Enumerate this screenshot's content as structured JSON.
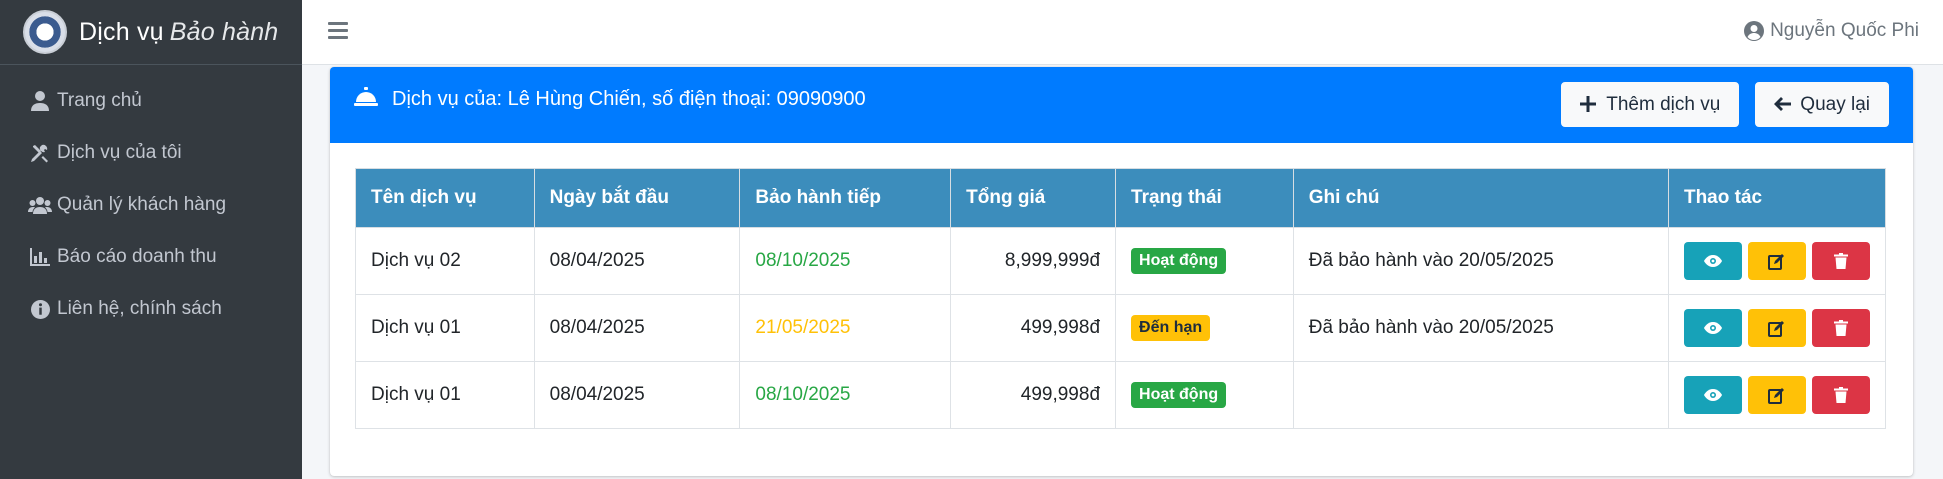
{
  "app": {
    "brand_main": "Dịch vụ",
    "brand_italic": "Bảo hành",
    "logo_icon": "shield-logo-icon"
  },
  "sidebar": {
    "items": [
      {
        "label": "Trang chủ",
        "icon": "user-icon"
      },
      {
        "label": "Dịch vụ của tôi",
        "icon": "tools-icon"
      },
      {
        "label": "Quản lý khách hàng",
        "icon": "users-icon"
      },
      {
        "label": "Báo cáo doanh thu",
        "icon": "bar-chart-icon"
      },
      {
        "label": "Liên hệ, chính sách",
        "icon": "info-circle-icon"
      }
    ]
  },
  "topbar": {
    "user_name": "Nguyễn Quốc Phi",
    "menu_icon": "hamburger-icon",
    "user_icon": "user-circle-icon"
  },
  "card": {
    "title": "Dịch vụ của: Lê Hùng Chiến, số điện thoại: 09090900",
    "title_icon": "concierge-bell-icon",
    "add_button": "Thêm dịch vụ",
    "back_button": "Quay lại"
  },
  "table": {
    "headers": [
      "Tên dịch vụ",
      "Ngày bắt đầu",
      "Bảo hành tiếp",
      "Tổng giá",
      "Trạng thái",
      "Ghi chú",
      "Thao tác"
    ],
    "rows": [
      {
        "name": "Dịch vụ 02",
        "start": "08/04/2025",
        "next": "08/10/2025",
        "next_status": "ok",
        "price": "8,999,999đ",
        "status": "Hoạt động",
        "status_type": "success",
        "note": "Đã bảo hành vào 20/05/2025"
      },
      {
        "name": "Dịch vụ 01",
        "start": "08/04/2025",
        "next": "21/05/2025",
        "next_status": "due",
        "price": "499,998đ",
        "status": "Đến hạn",
        "status_type": "warning",
        "note": "Đã bảo hành vào 20/05/2025"
      },
      {
        "name": "Dịch vụ 01",
        "start": "08/04/2025",
        "next": "08/10/2025",
        "next_status": "ok",
        "price": "499,998đ",
        "status": "Hoạt động",
        "status_type": "success",
        "note": ""
      }
    ]
  },
  "colors": {
    "primary": "#007bff",
    "table_header": "#3c8dbc",
    "sidebar": "#343a40",
    "success": "#28a745",
    "warning": "#ffc107",
    "danger": "#dc3545",
    "info": "#17a2b8"
  }
}
